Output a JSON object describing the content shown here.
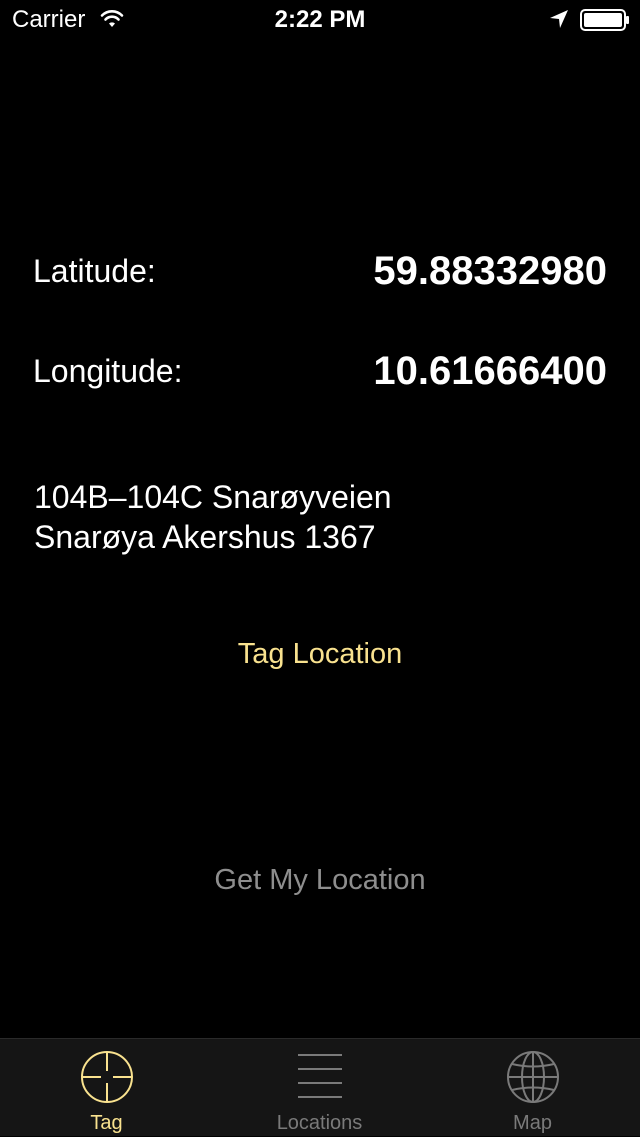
{
  "status_bar": {
    "carrier": "Carrier",
    "time": "2:22 PM"
  },
  "coordinates": {
    "latitude_label": "Latitude:",
    "latitude_value": "59.88332980",
    "longitude_label": "Longitude:",
    "longitude_value": "10.61666400"
  },
  "address": {
    "line1": "104B–104C Snarøyveien",
    "line2": "Snarøya Akershus 1367"
  },
  "buttons": {
    "tag_location": "Tag Location",
    "get_my_location": "Get My Location"
  },
  "tab_bar": {
    "tabs": [
      {
        "label": "Tag",
        "icon": "crosshair-icon",
        "selected": true
      },
      {
        "label": "Locations",
        "icon": "list-icon",
        "selected": false
      },
      {
        "label": "Map",
        "icon": "globe-icon",
        "selected": false
      }
    ]
  },
  "colors": {
    "background": "#000000",
    "accent": "#f9e28f",
    "disabled_text": "#8e8e8e",
    "tab_inactive": "#7a7a7a",
    "tab_bar_background": "#151515"
  }
}
